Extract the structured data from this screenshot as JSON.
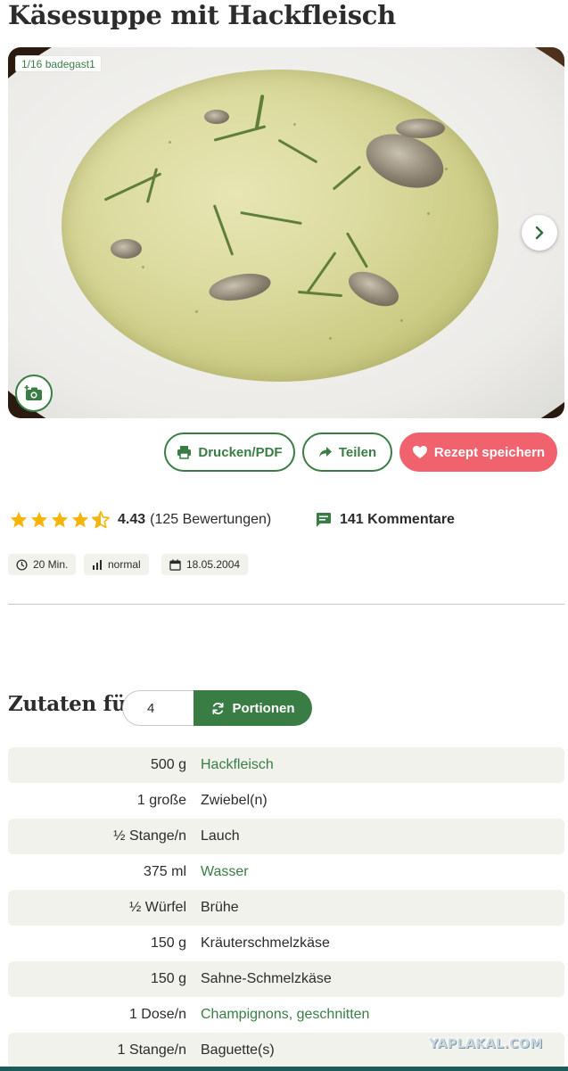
{
  "recipe": {
    "title": "Käsesuppe mit Hackfleisch"
  },
  "gallery": {
    "counter": "1/16 badegast1"
  },
  "actions": {
    "print_label": "Drucken/PDF",
    "share_label": "Teilen",
    "save_label": "Rezept speichern"
  },
  "rating": {
    "stars_value": 4.43,
    "value_text": "4.43",
    "count_text": "(125 Bewertungen)",
    "comments_text": "141 Kommentare"
  },
  "meta": {
    "time": "20 Min.",
    "difficulty": "normal",
    "date": "18.05.2004"
  },
  "portions": {
    "label": "Zutaten für",
    "value": "4",
    "button_label": "Portionen"
  },
  "ingredients": [
    {
      "amount": "500 g",
      "name": "Hackfleisch",
      "link": true
    },
    {
      "amount": "1 große",
      "name": "Zwiebel(n)",
      "link": false
    },
    {
      "amount": "½ Stange/n",
      "name": "Lauch",
      "link": false
    },
    {
      "amount": "375 ml",
      "name": "Wasser",
      "link": true
    },
    {
      "amount": "½ Würfel",
      "name": "Brühe",
      "link": false
    },
    {
      "amount": "150 g",
      "name": "Kräuterschmelzkäse",
      "link": false
    },
    {
      "amount": "150 g",
      "name": "Sahne-Schmelzkäse",
      "link": false
    },
    {
      "amount": "1 Dose/n",
      "name": "Champignons, geschnitten",
      "link": true
    },
    {
      "amount": "1 Stange/n",
      "name": "Baguette(s)",
      "link": false
    }
  ],
  "colors": {
    "accent_green": "#3a7d44",
    "save_red": "#f0636e",
    "star_yellow": "#f5b50a"
  },
  "watermark": "YAPLAKAL.COM"
}
